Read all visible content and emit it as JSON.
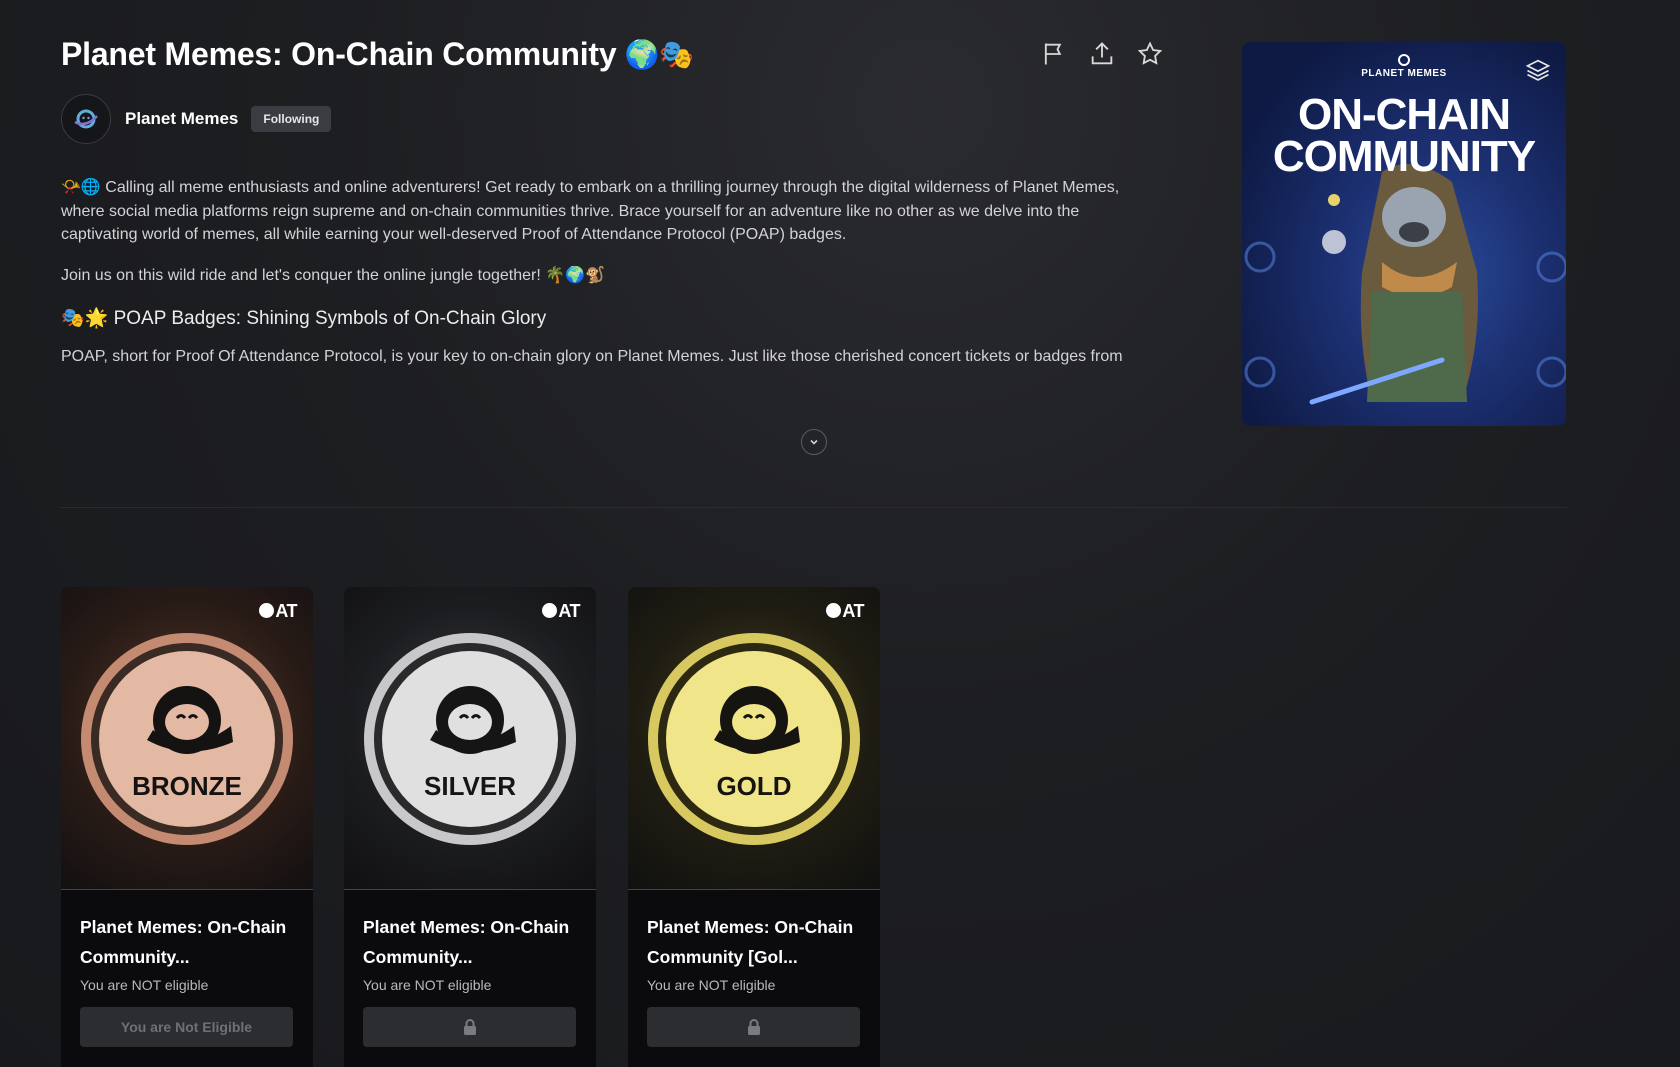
{
  "campaign": {
    "title": "Planet Memes: On-Chain Community",
    "title_emoji": "🌍🎭",
    "creator": {
      "name": "Planet Memes",
      "follow_status": "Following"
    }
  },
  "actions": {
    "icons": [
      "flag-icon",
      "share-icon",
      "star-icon"
    ]
  },
  "description": {
    "para1_emoji": "📯🌐",
    "para1": "Calling all meme enthusiasts and online adventurers! Get ready to embark on a thrilling journey through the digital wilderness of Planet Memes, where social media platforms reign supreme and on-chain communities thrive. Brace yourself for an adventure like no other as we delve into the captivating world of memes, all while earning your well-deserved Proof of Attendance Protocol (POAP) badges.",
    "para2": "Join us on this wild ride and let's conquer the online jungle together!",
    "para2_emoji": "🌴🌍🐒",
    "heading_emoji": "🎭🌟",
    "heading": "POAP Badges: Shining Symbols of On-Chain Glory",
    "para3": "POAP, short for Proof Of Attendance Protocol, is your key to on-chain glory on Planet Memes. Just like those cherished concert tickets or badges from"
  },
  "cover": {
    "brand": "PLANET MEMES",
    "headline_1": "ON-CHAIN",
    "headline_2": "COMMUNITY"
  },
  "cards": [
    {
      "brand": "AT",
      "medal_text": "BRONZE",
      "name": "Planet Memes: On-Chain Community...",
      "eligibility": "You are NOT eligible",
      "button": "You are Not Eligible",
      "color": "#e3b9a4"
    },
    {
      "brand": "AT",
      "medal_text": "SILVER",
      "name": "Planet Memes: On-Chain Community...",
      "eligibility": "You are NOT eligible",
      "button": "",
      "color": "#e0e0e0"
    },
    {
      "brand": "AT",
      "medal_text": "GOLD",
      "name": "Planet Memes: On-Chain Community [Gol...",
      "eligibility": "You are NOT eligible",
      "button": "",
      "color": "#f1e58a"
    }
  ]
}
